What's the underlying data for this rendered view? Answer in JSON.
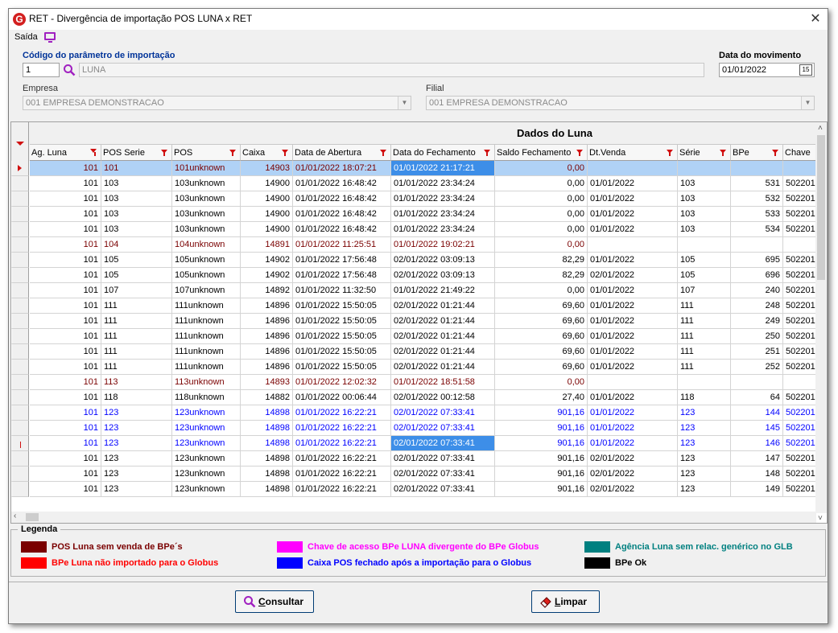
{
  "window": {
    "title": "RET - Divergência de importação POS LUNA x RET",
    "app_icon_letter": "G",
    "close_glyph": "✕"
  },
  "menu": {
    "saida": "Saída",
    "monitor_icon": "monitor-icon"
  },
  "form": {
    "codigo_label": "Código do parâmetro de importação",
    "codigo_value": "1",
    "codigo_desc": "LUNA",
    "data_mov_label": "Data do movimento",
    "data_mov_value": "01/01/2022",
    "data_mov_btn": "15",
    "empresa_label": "Empresa",
    "empresa_value": "001 EMPRESA DEMONSTRACAO",
    "filial_label": "Filial",
    "filial_value": "001 EMPRESA DEMONSTRACAO"
  },
  "grid": {
    "band_title": "Dados do Luna",
    "columns": [
      "Ag. Luna",
      "POS Serie",
      "POS",
      "Caixa",
      "Data de Abertura",
      "Data do Fechamento",
      "Saldo Fechamento",
      "Dt.Venda",
      "Série",
      "BPe",
      "Chave"
    ],
    "rows": [
      {
        "status": "selected",
        "cells": [
          "101",
          "101",
          "101unknown",
          "14903",
          "01/01/2022 18:07:21",
          "01/01/2022 21:17:21",
          "0,00",
          "",
          "",
          "",
          ""
        ]
      },
      {
        "status": "ok",
        "cells": [
          "101",
          "103",
          "103unknown",
          "14900",
          "01/01/2022 16:48:42",
          "01/01/2022 23:34:24",
          "0,00",
          "01/01/2022",
          "103",
          "531",
          "502201"
        ]
      },
      {
        "status": "ok",
        "cells": [
          "101",
          "103",
          "103unknown",
          "14900",
          "01/01/2022 16:48:42",
          "01/01/2022 23:34:24",
          "0,00",
          "01/01/2022",
          "103",
          "532",
          "502201"
        ]
      },
      {
        "status": "ok",
        "cells": [
          "101",
          "103",
          "103unknown",
          "14900",
          "01/01/2022 16:48:42",
          "01/01/2022 23:34:24",
          "0,00",
          "01/01/2022",
          "103",
          "533",
          "502201"
        ]
      },
      {
        "status": "ok",
        "cells": [
          "101",
          "103",
          "103unknown",
          "14900",
          "01/01/2022 16:48:42",
          "01/01/2022 23:34:24",
          "0,00",
          "01/01/2022",
          "103",
          "534",
          "502201"
        ]
      },
      {
        "status": "no_sale",
        "cells": [
          "101",
          "104",
          "104unknown",
          "14891",
          "01/01/2022 11:25:51",
          "01/01/2022 19:02:21",
          "0,00",
          "",
          "",
          "",
          ""
        ]
      },
      {
        "status": "ok",
        "cells": [
          "101",
          "105",
          "105unknown",
          "14902",
          "01/01/2022 17:56:48",
          "02/01/2022 03:09:13",
          "82,29",
          "01/01/2022",
          "105",
          "695",
          "502201"
        ]
      },
      {
        "status": "ok",
        "cells": [
          "101",
          "105",
          "105unknown",
          "14902",
          "01/01/2022 17:56:48",
          "02/01/2022 03:09:13",
          "82,29",
          "02/01/2022",
          "105",
          "696",
          "502201"
        ]
      },
      {
        "status": "ok",
        "cells": [
          "101",
          "107",
          "107unknown",
          "14892",
          "01/01/2022 11:32:50",
          "01/01/2022 21:49:22",
          "0,00",
          "01/01/2022",
          "107",
          "240",
          "502201"
        ]
      },
      {
        "status": "ok",
        "cells": [
          "101",
          "111",
          "111unknown",
          "14896",
          "01/01/2022 15:50:05",
          "02/01/2022 01:21:44",
          "69,60",
          "01/01/2022",
          "111",
          "248",
          "502201"
        ]
      },
      {
        "status": "ok",
        "cells": [
          "101",
          "111",
          "111unknown",
          "14896",
          "01/01/2022 15:50:05",
          "02/01/2022 01:21:44",
          "69,60",
          "01/01/2022",
          "111",
          "249",
          "502201"
        ]
      },
      {
        "status": "ok",
        "cells": [
          "101",
          "111",
          "111unknown",
          "14896",
          "01/01/2022 15:50:05",
          "02/01/2022 01:21:44",
          "69,60",
          "01/01/2022",
          "111",
          "250",
          "502201"
        ]
      },
      {
        "status": "ok",
        "cells": [
          "101",
          "111",
          "111unknown",
          "14896",
          "01/01/2022 15:50:05",
          "02/01/2022 01:21:44",
          "69,60",
          "01/01/2022",
          "111",
          "251",
          "502201"
        ]
      },
      {
        "status": "ok",
        "cells": [
          "101",
          "111",
          "111unknown",
          "14896",
          "01/01/2022 15:50:05",
          "02/01/2022 01:21:44",
          "69,60",
          "01/01/2022",
          "111",
          "252",
          "502201"
        ]
      },
      {
        "status": "no_sale",
        "cells": [
          "101",
          "113",
          "113unknown",
          "14893",
          "01/01/2022 12:02:32",
          "01/01/2022 18:51:58",
          "0,00",
          "",
          "",
          "",
          ""
        ]
      },
      {
        "status": "ok",
        "cells": [
          "101",
          "118",
          "118unknown",
          "14882",
          "01/01/2022 00:06:44",
          "02/01/2022 00:12:58",
          "27,40",
          "01/01/2022",
          "118",
          "64",
          "502201"
        ]
      },
      {
        "status": "closed_after",
        "cells": [
          "101",
          "123",
          "123unknown",
          "14898",
          "01/01/2022 16:22:21",
          "02/01/2022 07:33:41",
          "901,16",
          "01/01/2022",
          "123",
          "144",
          "502201"
        ]
      },
      {
        "status": "closed_after",
        "cells": [
          "101",
          "123",
          "123unknown",
          "14898",
          "01/01/2022 16:22:21",
          "02/01/2022 07:33:41",
          "901,16",
          "01/01/2022",
          "123",
          "145",
          "502201"
        ]
      },
      {
        "status": "closed_after_focus",
        "cells": [
          "101",
          "123",
          "123unknown",
          "14898",
          "01/01/2022 16:22:21",
          "02/01/2022 07:33:41",
          "901,16",
          "01/01/2022",
          "123",
          "146",
          "502201"
        ]
      },
      {
        "status": "ok",
        "cells": [
          "101",
          "123",
          "123unknown",
          "14898",
          "01/01/2022 16:22:21",
          "02/01/2022 07:33:41",
          "901,16",
          "02/01/2022",
          "123",
          "147",
          "502201"
        ]
      },
      {
        "status": "ok",
        "cells": [
          "101",
          "123",
          "123unknown",
          "14898",
          "01/01/2022 16:22:21",
          "02/01/2022 07:33:41",
          "901,16",
          "02/01/2022",
          "123",
          "148",
          "502201"
        ]
      },
      {
        "status": "ok",
        "cells": [
          "101",
          "123",
          "123unknown",
          "14898",
          "01/01/2022 16:22:21",
          "02/01/2022 07:33:41",
          "901,16",
          "02/01/2022",
          "123",
          "149",
          "502201"
        ]
      }
    ]
  },
  "legend": {
    "title": "Legenda",
    "items": [
      {
        "label": "POS Luna sem venda de BPe´s",
        "swatch": "#7a0000",
        "text_color": "#7a0000"
      },
      {
        "label": "BPe Luna não importado para o Globus",
        "swatch": "#ff0000",
        "text_color": "#ff0000"
      },
      {
        "label": "Chave de acesso BPe LUNA divergente do BPe Globus",
        "swatch": "#ff00ff",
        "text_color": "#ff00ff"
      },
      {
        "label": "Caixa POS fechado após a importação para o Globus",
        "swatch": "#0000ff",
        "text_color": "#0000ff"
      },
      {
        "label": "Agência Luna sem relac.  genérico no GLB",
        "swatch": "#008080",
        "text_color": "#008080"
      },
      {
        "label": "BPe Ok",
        "swatch": "#000000",
        "text_color": "#000000"
      }
    ]
  },
  "buttons": {
    "consultar": "Consultar",
    "limpar": "Limpar"
  },
  "colors": {
    "no_sale": "#7a0000",
    "closed_after": "#0000ff",
    "ok": "#000000",
    "selection": "#b0d2f6",
    "focus": "#3d8ee8"
  }
}
